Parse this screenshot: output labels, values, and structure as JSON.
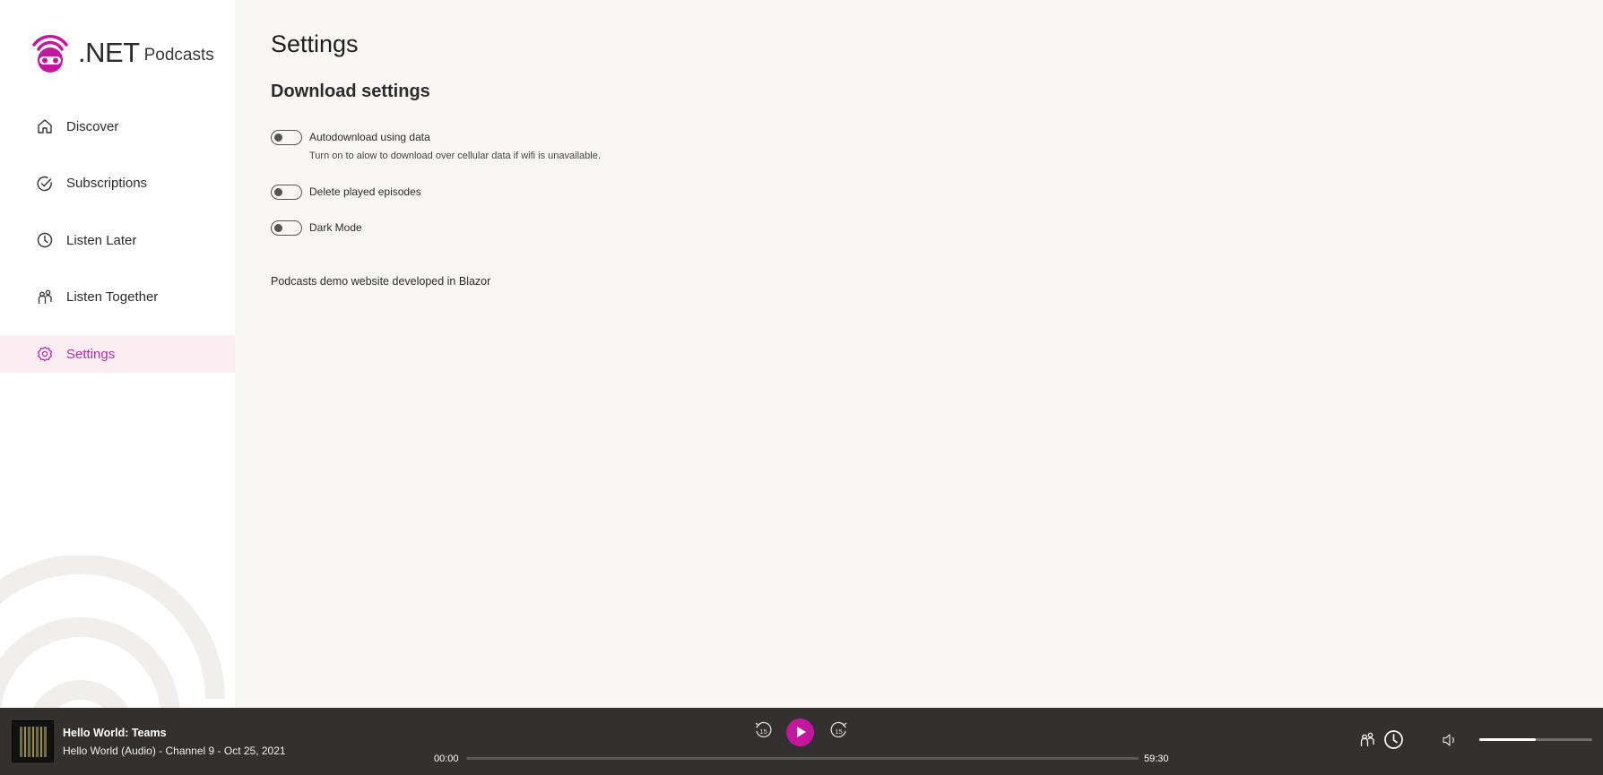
{
  "app": {
    "logo_net": ".NET",
    "logo_podcasts": "Podcasts",
    "brand_color": "#c4169f"
  },
  "sidebar": {
    "items": [
      {
        "label": "Discover",
        "icon": "home-icon"
      },
      {
        "label": "Subscriptions",
        "icon": "check-circle-icon"
      },
      {
        "label": "Listen Later",
        "icon": "clock-icon"
      },
      {
        "label": "Listen Together",
        "icon": "people-icon"
      },
      {
        "label": "Settings",
        "icon": "settings-gear-icon",
        "active": true
      }
    ]
  },
  "main": {
    "title": "Settings",
    "section_title": "Download settings",
    "settings": [
      {
        "label": "Autodownload using data",
        "description": "Turn on to alow to download over cellular data if wifi is unavailable.",
        "enabled": false
      },
      {
        "label": "Delete played episodes",
        "enabled": false
      },
      {
        "label": "Dark Mode",
        "enabled": false
      }
    ],
    "footer_note": "Podcasts demo website developed in Blazor"
  },
  "player": {
    "episode_title": "Hello World: Teams",
    "episode_subtitle": "Hello World (Audio) - Channel 9 - Oct 25, 2021",
    "time_current": "00:00",
    "time_total": "59:30",
    "progress_fraction": 0,
    "volume_fraction": 0.5,
    "skip_back_seconds": "15",
    "skip_forward_seconds": "15"
  }
}
